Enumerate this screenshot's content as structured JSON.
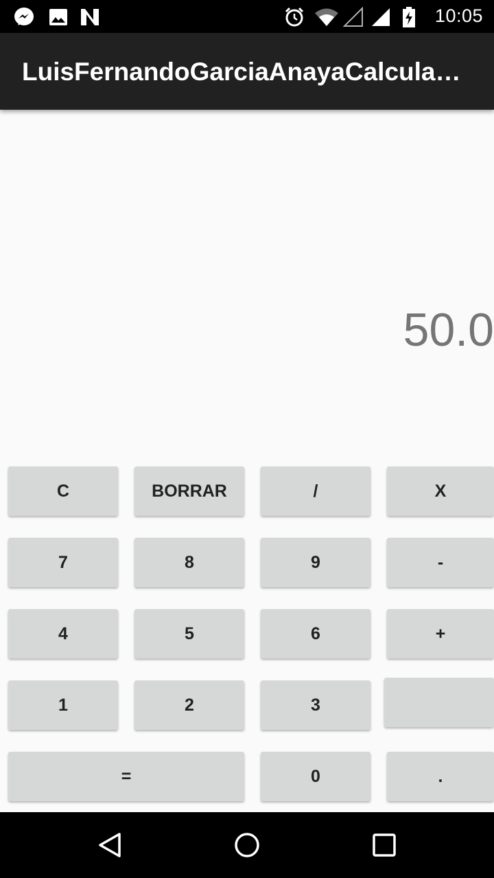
{
  "status_bar": {
    "time": "10:05",
    "left_icons": [
      "messenger-icon",
      "image-icon",
      "n-notification-icon"
    ],
    "right_icons": [
      "alarm-icon",
      "wifi-icon",
      "signal-empty-icon",
      "signal-full-icon",
      "battery-charging-icon"
    ]
  },
  "app_bar": {
    "title": "LuisFernandoGarciaAnayaCalcula…"
  },
  "display": {
    "value": "50.0"
  },
  "keypad": {
    "row1": [
      "C",
      "BORRAR",
      "/",
      "X"
    ],
    "row2": [
      "7",
      "8",
      "9",
      "-"
    ],
    "row3": [
      "4",
      "5",
      "6",
      "+"
    ],
    "row4": [
      "1",
      "2",
      "3",
      ""
    ],
    "row5": [
      "=",
      "0",
      "."
    ]
  },
  "nav_bar": {
    "icons": [
      "back-icon",
      "home-icon",
      "recents-icon"
    ]
  },
  "colors": {
    "app_bar": "#212121",
    "background": "#fafafa",
    "button": "#d6d7d7",
    "display_text": "#757575"
  }
}
